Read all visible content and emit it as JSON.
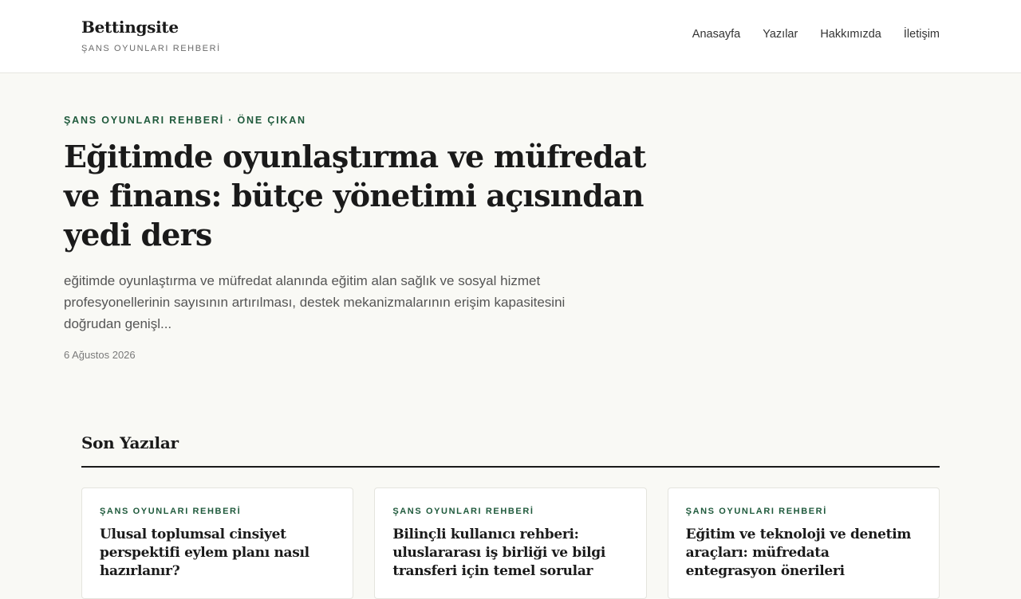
{
  "site": {
    "name": "Bettingsite",
    "tagline": "ŞANS OYUNLARI REHBERİ"
  },
  "nav": [
    {
      "label": "Anasayfa"
    },
    {
      "label": "Yazılar"
    },
    {
      "label": "Hakkımızda"
    },
    {
      "label": "İletişim"
    }
  ],
  "hero": {
    "eyebrow": "ŞANS OYUNLARI REHBERİ · ÖNE ÇIKAN",
    "title": "Eğitimde oyunlaştırma ve müfredat ve finans: bütçe yönetimi açısından yedi ders",
    "excerpt": "eğitimde oyunlaştırma ve müfredat alanında eğitim alan sağlık ve sosyal hizmet profesyonellerinin sayısının artırılması, destek mekanizmalarının erişim kapasitesini doğrudan genişl...",
    "date": "6 Ağustos 2026"
  },
  "recent": {
    "heading": "Son Yazılar",
    "posts": [
      {
        "category": "ŞANS OYUNLARI REHBERİ",
        "title": "Ulusal toplumsal cinsiyet perspektifi eylem planı nasıl hazırlanır?"
      },
      {
        "category": "ŞANS OYUNLARI REHBERİ",
        "title": "Bilinçli kullanıcı rehberi: uluslararası iş birliği ve bilgi transferi için temel sorular"
      },
      {
        "category": "ŞANS OYUNLARI REHBERİ",
        "title": "Eğitim ve teknoloji ve denetim araçları: müfredata entegrasyon önerileri"
      }
    ]
  }
}
